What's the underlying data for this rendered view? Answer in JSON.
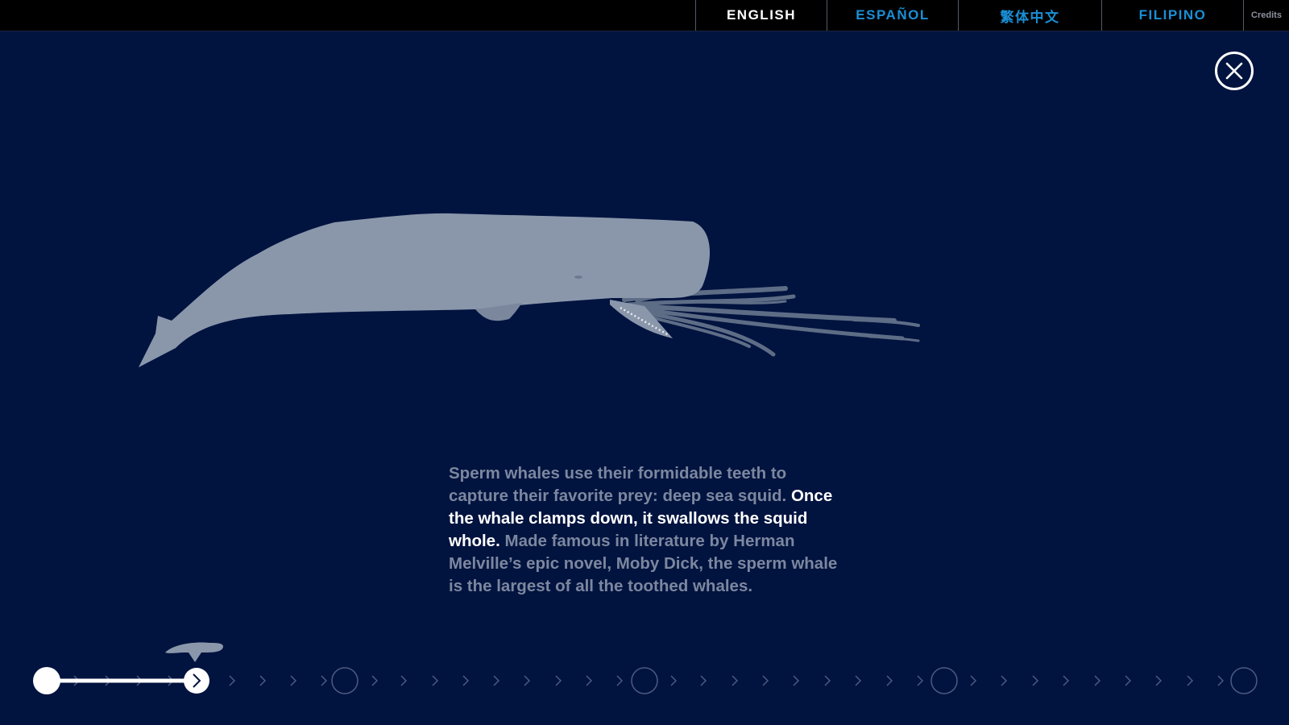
{
  "languages": [
    {
      "label": "ENGLISH",
      "active": true
    },
    {
      "label": "ESPAÑOL",
      "active": false
    },
    {
      "label": "繁体中文",
      "active": false
    },
    {
      "label": "FILIPINO",
      "active": false
    }
  ],
  "credits_label": "Credits",
  "close_icon": "close-icon",
  "story": {
    "part1": "Sperm whales use their formidable teeth to capture their favorite prey: deep sea squid.",
    "highlight": "Once the whale clamps down, it swallows the squid whole.",
    "part2": "Made famous in literature by Herman Melville’s epic novel, Moby Dick, the sperm whale is the largest of all the toothed whales."
  },
  "timeline": {
    "progress": 0.12,
    "current_step": 2
  },
  "colors": {
    "background": "#01133f",
    "topbar": "#000000",
    "accent_link": "#1a8fd6",
    "whale": "#8a97ab",
    "squid": "#5e6d86",
    "dim_text": "#7c879f",
    "highlight_text": "#ffffff"
  }
}
